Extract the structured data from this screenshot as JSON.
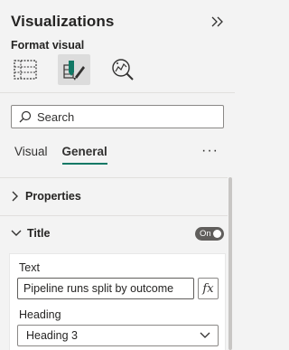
{
  "pane": {
    "title": "Visualizations",
    "subtitle": "Format visual",
    "collapse_icon": "double-chevron-right-icon",
    "tools": [
      {
        "name": "build-visual",
        "icon": "table-grid-icon",
        "selected": false
      },
      {
        "name": "format-visual",
        "icon": "paintbrush-format-icon",
        "selected": true
      },
      {
        "name": "analytics",
        "icon": "analytics-magnifier-icon",
        "selected": false
      }
    ]
  },
  "search": {
    "placeholder": "Search",
    "value": ""
  },
  "tabs": [
    {
      "label": "Visual",
      "active": false
    },
    {
      "label": "General",
      "active": true
    }
  ],
  "more_label": "···",
  "sections": {
    "properties": {
      "label": "Properties",
      "expanded": false
    },
    "title": {
      "label": "Title",
      "expanded": true,
      "toggle_label": "On",
      "toggle_on": true
    }
  },
  "title_card": {
    "text_label": "Text",
    "text_value": "Pipeline runs split by outcome",
    "fx_label": "fx",
    "heading_label": "Heading",
    "heading_value": "Heading 3"
  },
  "colors": {
    "accent": "#117865",
    "toggle_bg": "#605e5c",
    "pane_bg": "#f3f3f3"
  }
}
